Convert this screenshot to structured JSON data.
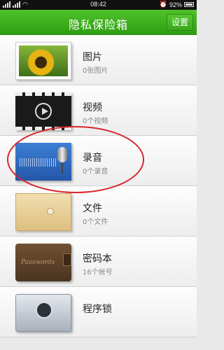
{
  "status_bar": {
    "time": "08:42",
    "battery": "92%"
  },
  "header": {
    "title": "隐私保险箱",
    "settings_label": "设置"
  },
  "items": [
    {
      "name": "图片",
      "sub": "0张图片",
      "icon": "photo-icon"
    },
    {
      "name": "视频",
      "sub": "0个视频",
      "icon": "video-icon"
    },
    {
      "name": "录音",
      "sub": "0个录音",
      "icon": "microphone-icon"
    },
    {
      "name": "文件",
      "sub": "0个文件",
      "icon": "folder-icon"
    },
    {
      "name": "密码本",
      "sub": "16个帐号",
      "icon": "wallet-icon"
    },
    {
      "name": "程序锁",
      "sub": "",
      "icon": "safe-lock-icon"
    }
  ],
  "wallet_word": "Passwords",
  "colors": {
    "header_green": "#3aaa1c",
    "annotation_red": "#d8262c"
  }
}
